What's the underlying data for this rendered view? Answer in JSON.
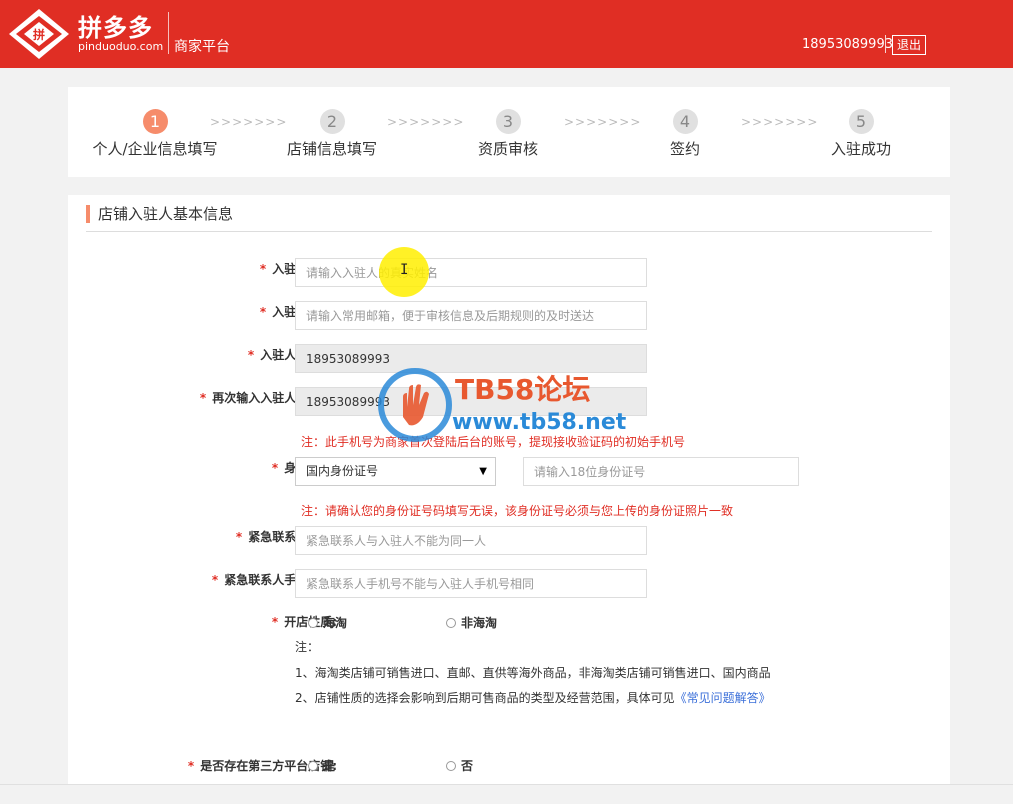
{
  "header": {
    "brand_name": "拼多多",
    "brand_domain": "pinduoduo.com",
    "platform": "商家平台",
    "user_phone": "18953089993",
    "logout_label": "退出",
    "brand_color": "#e02e24"
  },
  "steps": [
    {
      "num": "1",
      "label": "个人/企业信息填写",
      "active": true
    },
    {
      "num": "2",
      "label": "店铺信息填写",
      "active": false
    },
    {
      "num": "3",
      "label": "资质审核",
      "active": false
    },
    {
      "num": "4",
      "label": "签约",
      "active": false
    },
    {
      "num": "5",
      "label": "入驻成功",
      "active": false
    }
  ],
  "step_separator": ">>>>>>>",
  "form": {
    "section_title": "店铺入驻人基本信息",
    "name": {
      "label": "入驻人姓名:",
      "placeholder": "请输入入驻人的真实姓名",
      "value": ""
    },
    "email": {
      "label": "入驻人邮箱:",
      "placeholder": "请输入常用邮箱，便于审核信息及后期规则的及时送达",
      "value": ""
    },
    "phone": {
      "label": "入驻人手机号:",
      "value": "18953089993"
    },
    "phone_confirm": {
      "label": "再次输入入驻人手机号:",
      "value": "18953089993"
    },
    "phone_note": "注：此手机号为商家首次登陆后台的账号，提现接收验证码的初始手机号",
    "id_card": {
      "label": "身份证号:",
      "type_selected": "国内身份证号",
      "placeholder": "请输入18位身份证号",
      "value": ""
    },
    "id_note": "注：请确认您的身份证号码填写无误，该身份证号必须与您上传的身份证照片一致",
    "emergency_name": {
      "label": "紧急联系人名称:",
      "placeholder": "紧急联系人与入驻人不能为同一人",
      "value": ""
    },
    "emergency_phone": {
      "label": "紧急联系人手机号码:",
      "placeholder": "紧急联系人手机号不能与入驻人手机号相同",
      "value": ""
    },
    "shop_type": {
      "label": "开店性质:",
      "options": [
        "海淘",
        "非海淘"
      ],
      "note_title": "注：",
      "note_1": "1、海淘类店铺可销售进口、直邮、直供等海外商品，非海淘类店铺可销售进口、国内商品",
      "note_2_prefix": "2、店铺性质的选择会影响到后期可售商品的类型及经营范围，具体可见",
      "note_2_link": "《常见问题解答》"
    },
    "third_party": {
      "label": "是否存在第三方平台店铺:",
      "options": [
        "是",
        "否"
      ]
    }
  },
  "watermark": {
    "title": "TB58论坛",
    "url": "www.tb58.net"
  }
}
